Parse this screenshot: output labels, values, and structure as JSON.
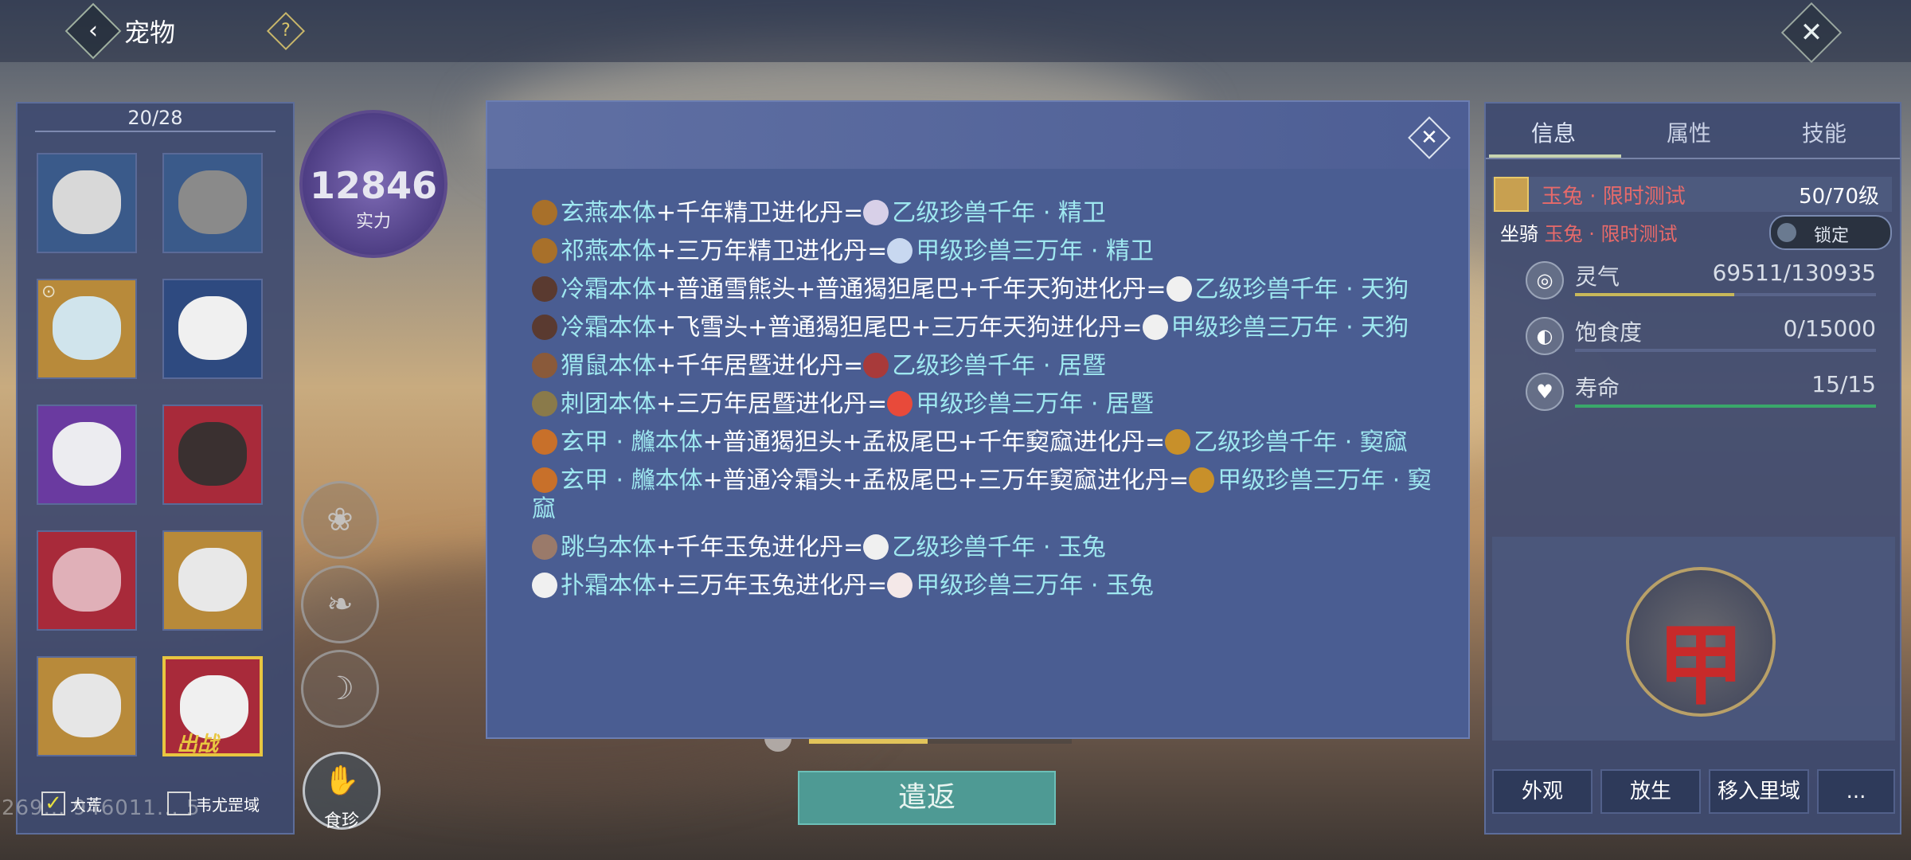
{
  "topbar": {
    "title": "宠物",
    "back_icon": "‹",
    "help_icon": "?",
    "close_icon": "✕"
  },
  "pet_list": {
    "count": "20/28",
    "slots": [
      {
        "name": "pet-slot-1",
        "color": "#3a5a8a",
        "face": "#d8d8d8"
      },
      {
        "name": "pet-slot-2",
        "color": "#3a5a8a",
        "face": "#8a8a8a"
      },
      {
        "name": "pet-slot-3",
        "color": "#b88a3a",
        "face": "#d0e4ec",
        "locked": true
      },
      {
        "name": "pet-slot-4",
        "color": "#2e4a80",
        "face": "#f0f0f0"
      },
      {
        "name": "pet-slot-5",
        "color": "#6a3aa0",
        "face": "#ececf0"
      },
      {
        "name": "pet-slot-6",
        "color": "#a82a3a",
        "face": "#3a3030"
      },
      {
        "name": "pet-slot-7",
        "color": "#a82a3a",
        "face": "#e0b0b8"
      },
      {
        "name": "pet-slot-8",
        "color": "#b88a3a",
        "face": "#e8e8e8"
      },
      {
        "name": "pet-slot-9",
        "color": "#b88a3a",
        "face": "#e6e6e6"
      },
      {
        "name": "pet-slot-10",
        "color": "#a82a3a",
        "face": "#f0f0f0",
        "active": true
      }
    ],
    "battle_label": "出战",
    "lock_icon": "⊙",
    "filter_1": {
      "label": "大荒",
      "checked": true
    },
    "filter_2": {
      "label": "韦尤罡域",
      "checked": false
    },
    "uid_watermark": "269... 946011... 5"
  },
  "power": {
    "value": "12846",
    "label": "实力"
  },
  "side_buttons": {
    "food_label": "食珍",
    "food_icon": "✋",
    "icons": [
      "❀",
      "❧",
      "☽"
    ]
  },
  "dialog": {
    "close_icon": "✕",
    "recipes": [
      {
        "icon": "#a8702a",
        "base": "玄燕本体",
        "mid": "+千年精卫进化丹=",
        "res_icon": "#d8d0e8",
        "result": "乙级珍兽千年 · 精卫"
      },
      {
        "icon": "#a8702a",
        "base": "祁燕本体",
        "mid": "+三万年精卫进化丹=",
        "res_icon": "#c8d8f0",
        "result": "甲级珍兽三万年 · 精卫"
      },
      {
        "icon": "#5a3a30",
        "base": "冷霜本体",
        "mid": "+普通雪熊头+普通猲狚尾巴+千年天狗进化丹=",
        "res_icon": "#f0f0f0",
        "result": "乙级珍兽千年 · 天狗"
      },
      {
        "icon": "#5a3a30",
        "base": "冷霜本体",
        "mid": "+飞雪头+普通猲狚尾巴+三万年天狗进化丹=",
        "res_icon": "#f0f0f0",
        "result": "甲级珍兽三万年 · 天狗"
      },
      {
        "icon": "#8a5a3a",
        "base": "猬鼠本体",
        "mid": "+千年居暨进化丹=",
        "res_icon": "#a83a3a",
        "result": "乙级珍兽千年 · 居暨"
      },
      {
        "icon": "#8a7a4a",
        "base": "刺团本体",
        "mid": "+三万年居暨进化丹=",
        "res_icon": "#e84a3a",
        "result": "甲级珍兽三万年 · 居暨"
      },
      {
        "icon": "#c8702a",
        "base": "玄甲 · 虪本体",
        "mid": "+普通猲狚头+孟极尾巴+千年窫窳进化丹=",
        "res_icon": "#c8902a",
        "result": "乙级珍兽千年 · 窫窳"
      },
      {
        "icon": "#c8702a",
        "base": "玄甲 · 虪本体",
        "mid": "+普通冷霜头+孟极尾巴+三万年窫窳进化丹=",
        "res_icon": "#c8902a",
        "result": "甲级珍兽三万年 · 窫窳"
      },
      {
        "icon": "#9a7a6a",
        "base": "跳乌本体",
        "mid": "+千年玉兔进化丹=",
        "res_icon": "#f0f0f0",
        "result": "乙级珍兽千年 · 玉兔"
      },
      {
        "icon": "#f0f0f0",
        "base": "扑霜本体",
        "mid": "+三万年玉兔进化丹=",
        "res_icon": "#f4e8e8",
        "result": "甲级珍兽三万年 · 玉兔"
      }
    ]
  },
  "dismiss": {
    "label": "遣返",
    "progress": 0.45
  },
  "info_panel": {
    "tabs": [
      "信息",
      "属性",
      "技能"
    ],
    "pet_name": "玉兔 · 限时测试",
    "level": "50/70级",
    "mount_label": "坐骑",
    "mount_name": "玉兔 · 限时测试",
    "lock_label": "锁定",
    "stats": [
      {
        "label": "灵气",
        "value": "69511/130935",
        "icon": "◎",
        "fill": 0.53,
        "color": "#c8b85a"
      },
      {
        "label": "饱食度",
        "value": "0/15000",
        "icon": "◐",
        "fill": 0.0,
        "color": "#6aa86a"
      },
      {
        "label": "寿命",
        "value": "15/15",
        "icon": "♥",
        "fill": 1.0,
        "color": "#3aa86a"
      }
    ],
    "grade": "甲",
    "buttons": [
      "外观",
      "放生",
      "移入里域",
      "..."
    ]
  }
}
